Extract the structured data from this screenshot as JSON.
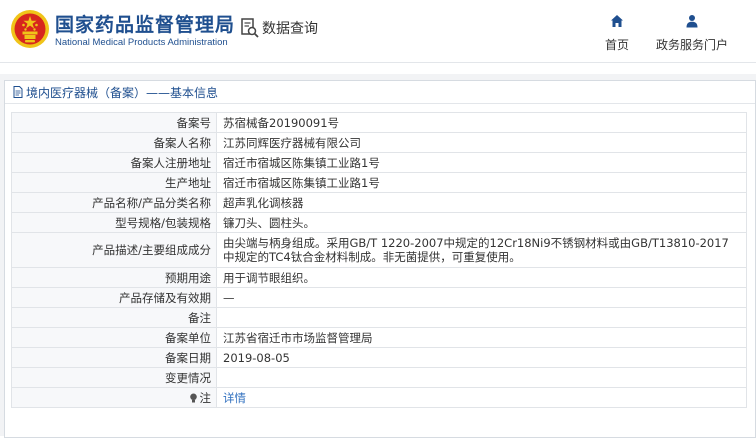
{
  "header": {
    "site_title": "国家药品监督管理局",
    "site_subtitle": "National Medical Products Administration",
    "data_query": "数据查询",
    "nav": {
      "home": "首页",
      "portal": "政务服务门户"
    }
  },
  "panel": {
    "title": "境内医疗器械（备案）——基本信息"
  },
  "rows": [
    {
      "label": "备案号",
      "value": "苏宿械备20190091号"
    },
    {
      "label": "备案人名称",
      "value": "江苏同辉医疗器械有限公司"
    },
    {
      "label": "备案人注册地址",
      "value": "宿迁市宿城区陈集镇工业路1号"
    },
    {
      "label": "生产地址",
      "value": "宿迁市宿城区陈集镇工业路1号"
    },
    {
      "label": "产品名称/产品分类名称",
      "value": "超声乳化调核器"
    },
    {
      "label": "型号规格/包装规格",
      "value": "镰刀头、圆柱头。"
    },
    {
      "label": "产品描述/主要组成成分",
      "value": "由尖端与柄身组成。采用GB/T 1220-2007中规定的12Cr18Ni9不锈钢材料或由GB/T13810-2017中规定的TC4钛合金材料制成。非无菌提供，可重复使用。"
    },
    {
      "label": "预期用途",
      "value": "用于调节眼组织。"
    },
    {
      "label": "产品存储及有效期",
      "value": "—"
    },
    {
      "label": "备注",
      "value": ""
    },
    {
      "label": "备案单位",
      "value": "江苏省宿迁市市场监督管理局"
    },
    {
      "label": "备案日期",
      "value": "2019-08-05"
    },
    {
      "label": "变更情况",
      "value": ""
    },
    {
      "label": "注",
      "value": "详情"
    }
  ],
  "colors": {
    "brand": "#1f4f8f",
    "link": "#2f6fbf",
    "emblem_red": "#d7261d",
    "emblem_gold": "#f0c419"
  }
}
